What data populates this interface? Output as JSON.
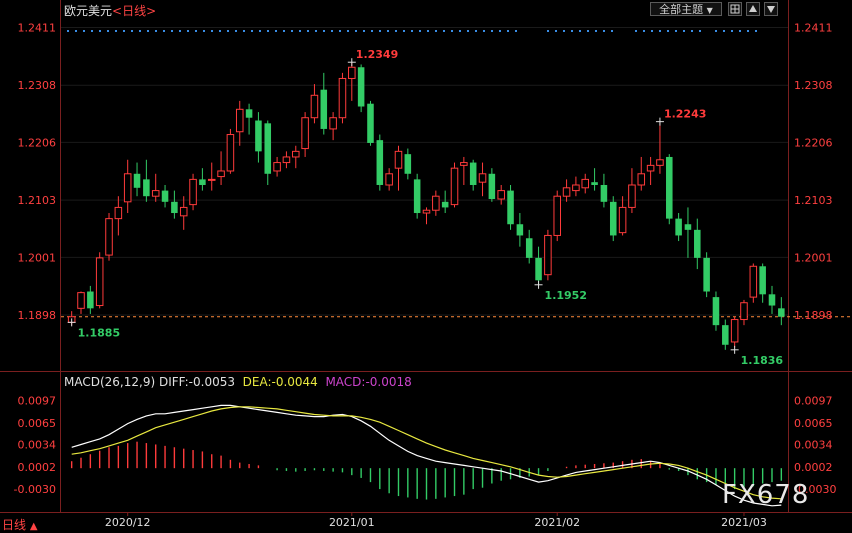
{
  "header": {
    "symbol": "欧元美元",
    "period_open": "<",
    "period": "日线",
    "period_close": ">",
    "theme_button": "全部主题",
    "theme_arrow": "▼"
  },
  "colors": {
    "background": "#000000",
    "up": "#ff3b3b",
    "down": "#33cc66",
    "axis_text": "#ff4040",
    "grid": "#3a3a3a",
    "dot_row": "#3a8ee6",
    "last_price_line": "#ff8a3a",
    "diff_line": "#ffffff",
    "dea_line": "#e8e840",
    "macd_text": "#cc44cc"
  },
  "price_axis": {
    "ticks": [
      "1.2411",
      "1.2308",
      "1.2206",
      "1.2103",
      "1.2001",
      "1.1898"
    ],
    "tick_values": [
      1.2411,
      1.2308,
      1.2206,
      1.2103,
      1.2001,
      1.1898
    ]
  },
  "macd_axis": {
    "ticks": [
      "0.0097",
      "0.0065",
      "0.0034",
      "0.0002",
      "-0.0030"
    ],
    "tick_values": [
      0.0097,
      0.0065,
      0.0034,
      0.0002,
      -0.003
    ]
  },
  "macd_header": {
    "params": "MACD(26,12,9)",
    "diff": "DIFF:-0.0053",
    "dea": "DEA:-0.0044",
    "macd": "MACD:-0.0018"
  },
  "annotations": {
    "high1": "1.2349",
    "high2": "1.2243",
    "low1": "1.1885",
    "low2": "1.1952",
    "low3": "1.1836"
  },
  "date_axis": [
    "2020/12",
    "2021/01",
    "2021/02",
    "2021/03"
  ],
  "footer": {
    "period_label": "日线",
    "arrow": "▲"
  },
  "watermark": "FX678",
  "chart_data": {
    "type": "candlestick",
    "title": "欧元美元 日线",
    "last_price": 1.1895,
    "price_range": [
      1.18,
      1.2435
    ],
    "candles": [
      [
        1.1885,
        1.1905,
        1.188,
        1.1895
      ],
      [
        1.191,
        1.194,
        1.19,
        1.1938
      ],
      [
        1.194,
        1.195,
        1.19,
        1.191
      ],
      [
        1.1915,
        1.201,
        1.191,
        1.2
      ],
      [
        1.2005,
        1.208,
        1.1995,
        1.207
      ],
      [
        1.207,
        1.211,
        1.204,
        1.209
      ],
      [
        1.21,
        1.2175,
        1.208,
        1.215
      ],
      [
        1.215,
        1.217,
        1.211,
        1.2125
      ],
      [
        1.214,
        1.2175,
        1.21,
        1.211
      ],
      [
        1.211,
        1.215,
        1.21,
        1.212
      ],
      [
        1.212,
        1.213,
        1.209,
        1.21
      ],
      [
        1.21,
        1.212,
        1.207,
        1.208
      ],
      [
        1.2075,
        1.211,
        1.205,
        1.209
      ],
      [
        1.2095,
        1.215,
        1.2085,
        1.214
      ],
      [
        1.214,
        1.216,
        1.212,
        1.213
      ],
      [
        1.214,
        1.217,
        1.212,
        1.214
      ],
      [
        1.2145,
        1.219,
        1.213,
        1.2155
      ],
      [
        1.2155,
        1.223,
        1.215,
        1.222
      ],
      [
        1.2225,
        1.228,
        1.22,
        1.2265
      ],
      [
        1.2265,
        1.2275,
        1.222,
        1.225
      ],
      [
        1.2245,
        1.226,
        1.217,
        1.219
      ],
      [
        1.224,
        1.2245,
        1.213,
        1.215
      ],
      [
        1.2155,
        1.218,
        1.2145,
        1.217
      ],
      [
        1.217,
        1.219,
        1.216,
        1.218
      ],
      [
        1.218,
        1.22,
        1.216,
        1.219
      ],
      [
        1.2195,
        1.226,
        1.218,
        1.225
      ],
      [
        1.225,
        1.231,
        1.224,
        1.229
      ],
      [
        1.23,
        1.233,
        1.222,
        1.223
      ],
      [
        1.223,
        1.226,
        1.221,
        1.225
      ],
      [
        1.225,
        1.233,
        1.224,
        1.232
      ],
      [
        1.232,
        1.2349,
        1.228,
        1.234
      ],
      [
        1.234,
        1.2345,
        1.226,
        1.227
      ],
      [
        1.2275,
        1.228,
        1.22,
        1.2205
      ],
      [
        1.221,
        1.222,
        1.212,
        1.213
      ],
      [
        1.213,
        1.216,
        1.212,
        1.215
      ],
      [
        1.216,
        1.22,
        1.212,
        1.219
      ],
      [
        1.2185,
        1.2195,
        1.214,
        1.215
      ],
      [
        1.214,
        1.215,
        1.207,
        1.208
      ],
      [
        1.208,
        1.209,
        1.206,
        1.2085
      ],
      [
        1.2085,
        1.212,
        1.2075,
        1.211
      ],
      [
        1.21,
        1.212,
        1.208,
        1.209
      ],
      [
        1.2095,
        1.217,
        1.209,
        1.216
      ],
      [
        1.2165,
        1.218,
        1.213,
        1.217
      ],
      [
        1.217,
        1.2175,
        1.212,
        1.213
      ],
      [
        1.2135,
        1.217,
        1.211,
        1.215
      ],
      [
        1.215,
        1.216,
        1.21,
        1.2105
      ],
      [
        1.2105,
        1.213,
        1.2095,
        1.212
      ],
      [
        1.212,
        1.213,
        1.205,
        1.206
      ],
      [
        1.206,
        1.208,
        1.202,
        1.204
      ],
      [
        1.2035,
        1.205,
        1.199,
        1.2
      ],
      [
        1.2,
        1.202,
        1.1952,
        1.196
      ],
      [
        1.197,
        1.205,
        1.196,
        1.204
      ],
      [
        1.204,
        1.212,
        1.203,
        1.211
      ],
      [
        1.211,
        1.214,
        1.21,
        1.2125
      ],
      [
        1.212,
        1.2145,
        1.211,
        1.213
      ],
      [
        1.2125,
        1.215,
        1.2115,
        1.214
      ],
      [
        1.2135,
        1.216,
        1.212,
        1.213
      ],
      [
        1.213,
        1.215,
        1.209,
        1.21
      ],
      [
        1.21,
        1.211,
        1.203,
        1.204
      ],
      [
        1.2045,
        1.211,
        1.204,
        1.209
      ],
      [
        1.209,
        1.216,
        1.208,
        1.213
      ],
      [
        1.213,
        1.218,
        1.212,
        1.215
      ],
      [
        1.2155,
        1.218,
        1.213,
        1.2165
      ],
      [
        1.2165,
        1.2243,
        1.215,
        1.2175
      ],
      [
        1.218,
        1.2185,
        1.206,
        1.207
      ],
      [
        1.207,
        1.208,
        1.203,
        1.204
      ],
      [
        1.206,
        1.209,
        1.2,
        1.205
      ],
      [
        1.205,
        1.207,
        1.198,
        1.2
      ],
      [
        1.2,
        1.201,
        1.193,
        1.194
      ],
      [
        1.193,
        1.194,
        1.187,
        1.188
      ],
      [
        1.188,
        1.189,
        1.1836,
        1.1845
      ],
      [
        1.185,
        1.1895,
        1.184,
        1.189
      ],
      [
        1.189,
        1.1925,
        1.188,
        1.192
      ],
      [
        1.193,
        1.199,
        1.192,
        1.1985
      ],
      [
        1.1985,
        1.199,
        1.192,
        1.1935
      ],
      [
        1.1935,
        1.195,
        1.19,
        1.1915
      ],
      [
        1.191,
        1.193,
        1.188,
        1.1895
      ]
    ],
    "macd_range": [
      -0.006,
      0.0115
    ],
    "macd_hist": [
      0.001,
      0.0015,
      0.002,
      0.0025,
      0.003,
      0.0032,
      0.0036,
      0.0038,
      0.0036,
      0.0034,
      0.0032,
      0.003,
      0.0028,
      0.0026,
      0.0024,
      0.002,
      0.0018,
      0.0012,
      0.0008,
      0.0006,
      0.0004,
      0.0,
      -0.0003,
      -0.0004,
      -0.0005,
      -0.0004,
      -0.0003,
      -0.0004,
      -0.0005,
      -0.0006,
      -0.001,
      -0.0014,
      -0.002,
      -0.003,
      -0.0036,
      -0.004,
      -0.0042,
      -0.0044,
      -0.0045,
      -0.0044,
      -0.0042,
      -0.004,
      -0.0038,
      -0.003,
      -0.0028,
      -0.0022,
      -0.0018,
      -0.0016,
      -0.0014,
      -0.0012,
      -0.001,
      -0.0004,
      0.0,
      0.0002,
      0.0004,
      0.0005,
      0.0006,
      0.0007,
      0.0008,
      0.001,
      0.0012,
      0.0013,
      0.001,
      0.0006,
      -0.0002,
      -0.0004,
      -0.001,
      -0.0016,
      -0.002,
      -0.0024,
      -0.003,
      -0.003,
      -0.0028,
      -0.0026,
      -0.0022,
      -0.002,
      -0.0018
    ],
    "diff": [
      0.003,
      0.0034,
      0.0038,
      0.0042,
      0.0048,
      0.0056,
      0.0064,
      0.007,
      0.0075,
      0.0078,
      0.0078,
      0.008,
      0.0082,
      0.0084,
      0.0086,
      0.0088,
      0.009,
      0.009,
      0.0088,
      0.0086,
      0.0084,
      0.0082,
      0.008,
      0.0078,
      0.0076,
      0.0075,
      0.0074,
      0.0074,
      0.0076,
      0.0077,
      0.0074,
      0.0068,
      0.006,
      0.005,
      0.004,
      0.0032,
      0.0024,
      0.0018,
      0.0014,
      0.001,
      0.0008,
      0.0006,
      0.0004,
      0.0002,
      0.0,
      -0.0002,
      -0.0004,
      -0.0008,
      -0.0012,
      -0.0016,
      -0.002,
      -0.0018,
      -0.0014,
      -0.001,
      -0.0006,
      -0.0004,
      -0.0002,
      0.0,
      0.0002,
      0.0004,
      0.0006,
      0.0008,
      0.001,
      0.0008,
      0.0004,
      0.0,
      -0.0004,
      -0.001,
      -0.0016,
      -0.0024,
      -0.0032,
      -0.004,
      -0.0046,
      -0.005,
      -0.0052,
      -0.0054,
      -0.0053
    ],
    "dea": [
      0.002,
      0.0022,
      0.0025,
      0.0028,
      0.0032,
      0.0036,
      0.004,
      0.0046,
      0.0052,
      0.0058,
      0.0062,
      0.0066,
      0.007,
      0.0074,
      0.0078,
      0.0082,
      0.0085,
      0.0087,
      0.0088,
      0.0088,
      0.0087,
      0.0086,
      0.0085,
      0.0083,
      0.0081,
      0.0079,
      0.0077,
      0.0076,
      0.0075,
      0.0075,
      0.0075,
      0.0073,
      0.007,
      0.0066,
      0.006,
      0.0054,
      0.0048,
      0.0042,
      0.0036,
      0.0031,
      0.0026,
      0.0022,
      0.0018,
      0.0014,
      0.0011,
      0.0008,
      0.0005,
      0.0002,
      -0.0002,
      -0.0006,
      -0.001,
      -0.0012,
      -0.0013,
      -0.0012,
      -0.001,
      -0.0008,
      -0.0006,
      -0.0004,
      -0.0002,
      0.0,
      0.0002,
      0.0004,
      0.0006,
      0.0007,
      0.0006,
      0.0004,
      0.0,
      -0.0005,
      -0.001,
      -0.0016,
      -0.0022,
      -0.0028,
      -0.0033,
      -0.0038,
      -0.0041,
      -0.0043,
      -0.0044
    ]
  }
}
